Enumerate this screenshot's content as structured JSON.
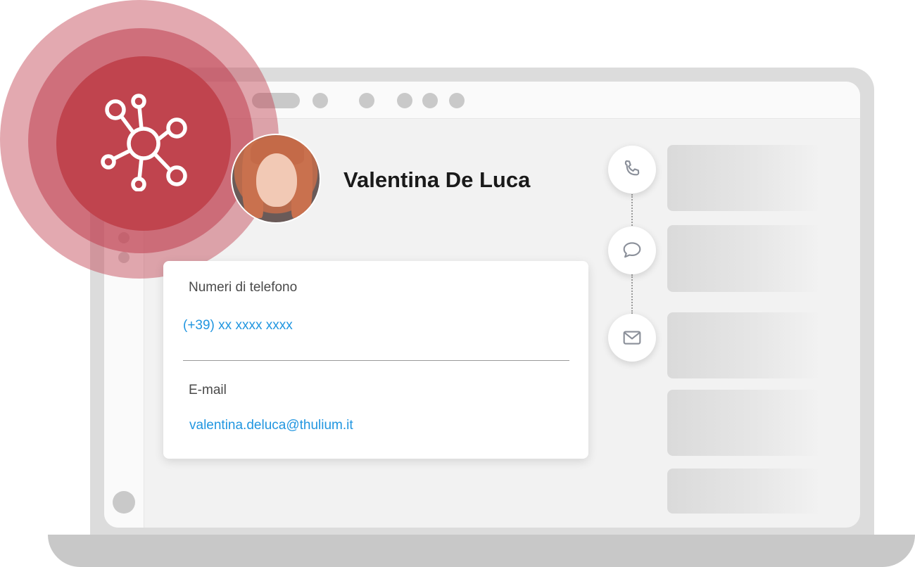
{
  "contact": {
    "name": "Valentina De Luca",
    "avatar_alt": "avatar"
  },
  "details": {
    "phone_label": "Numeri di telefono",
    "phone_value": "(+39) xx xxxx xxxx",
    "email_label": "E-mail",
    "email_value": "valentina.deluca@thulium.it"
  },
  "channels": [
    {
      "icon": "phone-icon"
    },
    {
      "icon": "chat-bubble-icon"
    },
    {
      "icon": "envelope-icon"
    }
  ],
  "brand": {
    "icon": "hub-network-icon",
    "accent": "#c0444e",
    "link_color": "#2196e0"
  }
}
